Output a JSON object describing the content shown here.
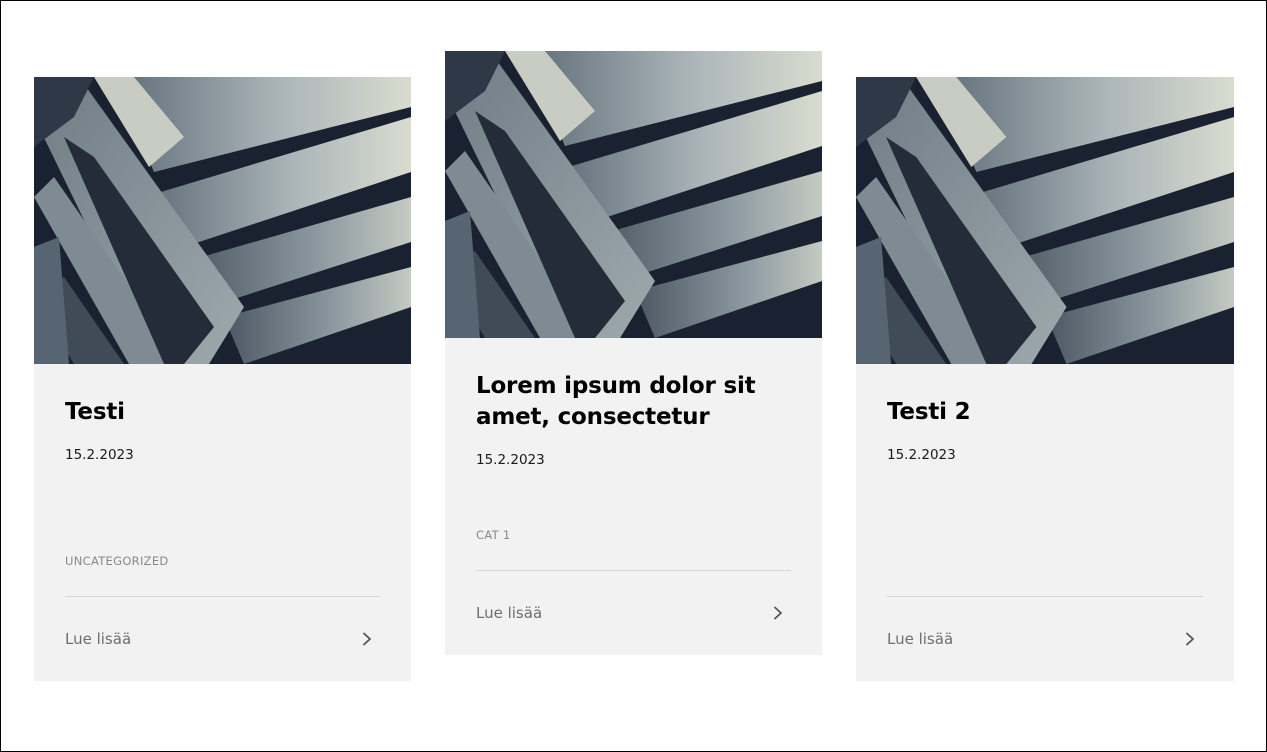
{
  "posts": [
    {
      "title": "Testi",
      "date": "15.2.2023",
      "category": "UNCATEGORIZED",
      "read_more": "Lue lisää",
      "image": "architecture-photo"
    },
    {
      "title": "Lorem ipsum dolor sit amet, consectetur",
      "date": "15.2.2023",
      "category": "CAT 1",
      "read_more": "Lue lisää",
      "image": "architecture-photo"
    },
    {
      "title": "Testi 2",
      "date": "15.2.2023",
      "category": "",
      "read_more": "Lue lisää",
      "image": "architecture-photo"
    }
  ],
  "colors": {
    "card_background": "#f2f2f2",
    "title": "#000000",
    "muted_text": "#6e6e6e",
    "category": "#888888",
    "divider": "#d6d6d6"
  },
  "icons": {
    "read_more": "chevron-right-icon"
  }
}
